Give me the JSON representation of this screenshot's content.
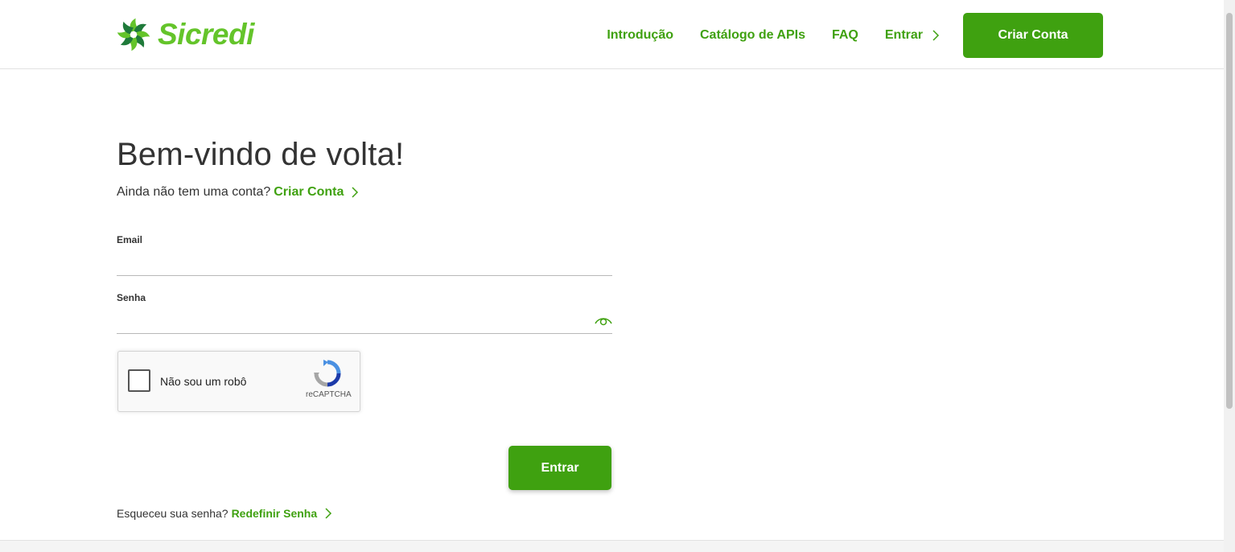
{
  "brand": {
    "name": "Sicredi",
    "color": "#3fa110",
    "light_color": "#64c42a"
  },
  "nav": {
    "items": [
      {
        "label": "Introdução"
      },
      {
        "label": "Catálogo de APIs"
      },
      {
        "label": "FAQ"
      },
      {
        "label": "Entrar"
      }
    ],
    "cta_label": "Criar Conta"
  },
  "login": {
    "title": "Bem-vindo de volta!",
    "subtitle": "Ainda não tem uma conta?",
    "signup_link": "Criar Conta",
    "email_label": "Email",
    "email_value": "",
    "senha_label": "Senha",
    "senha_value": "",
    "submit_label": "Entrar",
    "forgot_text": "Esqueceu sua senha?",
    "forgot_link": "Redefinir Senha"
  },
  "captcha": {
    "label": "Não sou um robô",
    "brand": "reCAPTCHA",
    "checked": false
  }
}
